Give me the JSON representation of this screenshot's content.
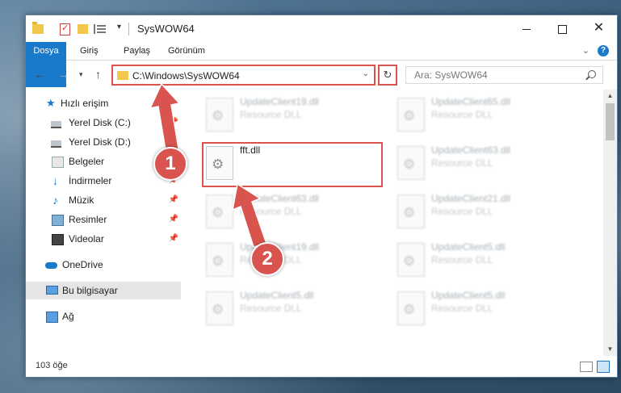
{
  "window": {
    "title": "SysWOW64",
    "quick_access_icons": [
      "folder-icon",
      "properties-icon",
      "new-folder-icon",
      "view-icon",
      "customize-chevron-icon"
    ]
  },
  "ribbon": {
    "tabs": [
      {
        "label": "Dosya",
        "active": true
      },
      {
        "label": "Giriş"
      },
      {
        "label": "Paylaş"
      },
      {
        "label": "Görünüm"
      }
    ],
    "accent_color": "#1979ca"
  },
  "address": {
    "path": "C:\\Windows\\SysWOW64",
    "search_placeholder": "Ara: SysWOW64"
  },
  "sidebar": {
    "quick_access": "Hızlı erişim",
    "items": [
      {
        "label": "Yerel Disk (C:)",
        "icon": "drive-icon",
        "pinned": true
      },
      {
        "label": "Yerel Disk (D:)",
        "icon": "drive-icon",
        "pinned": true
      },
      {
        "label": "Belgeler",
        "icon": "documents-icon",
        "pinned": true
      },
      {
        "label": "İndirmeler",
        "icon": "download-icon",
        "pinned": true
      },
      {
        "label": "Müzik",
        "icon": "music-icon",
        "pinned": true
      },
      {
        "label": "Resimler",
        "icon": "pictures-icon",
        "pinned": true
      },
      {
        "label": "Videolar",
        "icon": "videos-icon",
        "pinned": true
      }
    ],
    "onedrive": "OneDrive",
    "this_pc": "Bu bilgisayar",
    "network": "Ağ"
  },
  "files": [
    {
      "name": "UpdateClient19.dll",
      "desc": "Resource DLL"
    },
    {
      "name": "UpdateClient65.dll",
      "desc": "Resource DLL"
    },
    {
      "name": "fft.dll",
      "desc": ""
    },
    {
      "name": "UpdateClient63.dll",
      "desc": "Resource DLL"
    },
    {
      "name": "UpdateClient63.dll",
      "desc": "Resource DLL"
    },
    {
      "name": "UpdateClient21.dll",
      "desc": "Resource DLL"
    },
    {
      "name": "UpdateClient19.dll",
      "desc": "Resource DLL"
    },
    {
      "name": "UpdateClient5.dll",
      "desc": "Resource DLL"
    },
    {
      "name": "UpdateClient5.dll",
      "desc": "Resource DLL"
    },
    {
      "name": "UpdateClient5.dll",
      "desc": "Resource DLL"
    }
  ],
  "status": {
    "item_count": "103 öğe"
  },
  "annotations": {
    "badge_1": "1",
    "badge_2": "2",
    "color": "#d9534f"
  }
}
